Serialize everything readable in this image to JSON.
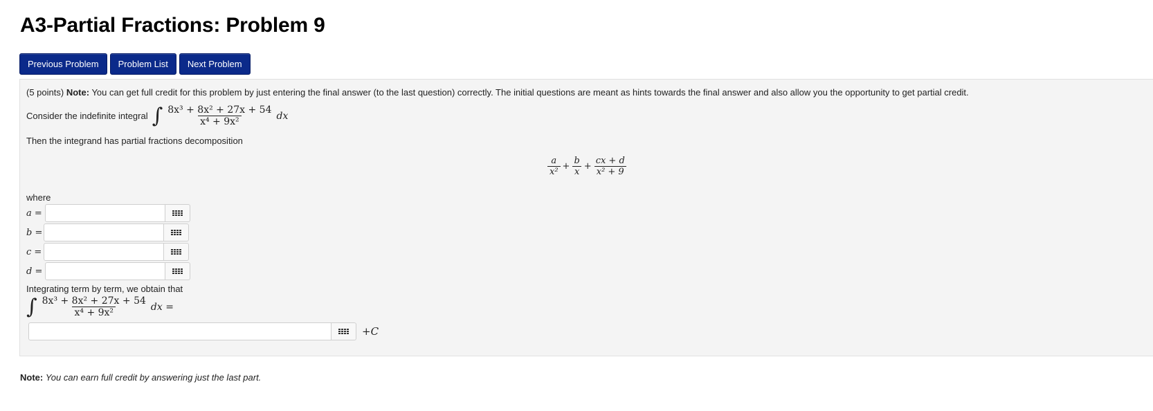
{
  "page": {
    "title": "A3-Partial Fractions: Problem 9"
  },
  "nav": {
    "prev": "Previous Problem",
    "list": "Problem List",
    "next": "Next Problem"
  },
  "problem": {
    "points": "(5 points)",
    "note_label": "Note:",
    "note_text": "You can get full credit for this problem by just entering the final answer (to the last question) correctly. The initial questions are meant as hints towards the final answer and also allow you the opportunity to get partial credit.",
    "consider": "Consider the indefinite integral",
    "integrand_num": "8x³ + 8x² + 27x + 54",
    "integrand_den": "x⁴ + 9x²",
    "dx": "dx",
    "decomp_intro": "Then the integrand has partial fractions decomposition",
    "decomp": {
      "t1_num": "a",
      "t1_den": "x²",
      "t2_num": "b",
      "t2_den": "x",
      "t3_num": "cx + d",
      "t3_den": "x² + 9",
      "plus": "+"
    },
    "where": "where",
    "vars": [
      {
        "name": "a",
        "label": "a =",
        "value": ""
      },
      {
        "name": "b",
        "label": "b =",
        "value": ""
      },
      {
        "name": "c",
        "label": "c =",
        "value": ""
      },
      {
        "name": "d",
        "label": "d =",
        "value": ""
      }
    ],
    "integrating": "Integrating term by term, we obtain that",
    "dx_eq": "dx =",
    "final_value": "",
    "plus_c": "+C"
  },
  "footer": {
    "note_label": "Note:",
    "note_text": "You can earn full credit by answering just the last part."
  }
}
